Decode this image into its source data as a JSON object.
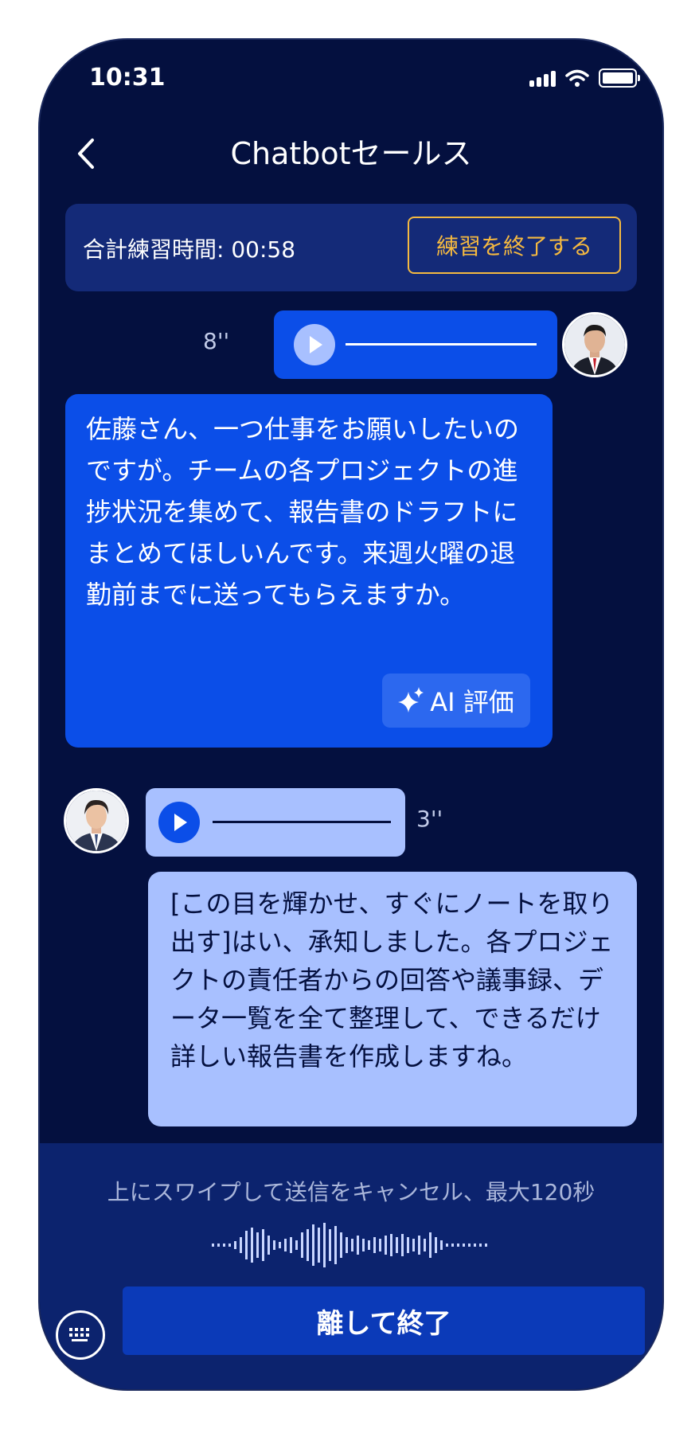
{
  "status_bar": {
    "time": "10:31"
  },
  "header": {
    "title": "Chatbotセールス"
  },
  "practice": {
    "total_time": "合計練習時間: 00:58",
    "end_button": "練習を終了する"
  },
  "messages": [
    {
      "role": "trainer",
      "audio_duration": "8''",
      "text": "佐藤さん、一つ仕事をお願いしたいのですが。チームの各プロジェクトの進捗状況を集めて、報告書のドラフトにまとめてほしいんです。来週火曜の退勤前までに送ってもらえますか。",
      "ai_button": "AI 評価"
    },
    {
      "role": "user",
      "audio_duration": "3''",
      "text": "[この目を輝かせ、すぐにノートを取り出す]はい、承知しました。各プロジェクトの責任者からの回答や議事録、データ一覧を全て整理して、できるだけ詳しい報告書を作成しますね。"
    }
  ],
  "recording": {
    "hint": "上にスワイプして送信をキャンセル、最大120秒",
    "release_button": "離して終了"
  },
  "colors": {
    "background": "#04103f",
    "accent_blue": "#0b4ee8",
    "light_blue": "#a8c0ff",
    "warning_yellow": "#f5b940"
  },
  "icons": [
    "back-icon",
    "signal-icon",
    "wifi-icon",
    "battery-icon",
    "play-icon",
    "sparkle-icon",
    "keyboard-icon"
  ]
}
